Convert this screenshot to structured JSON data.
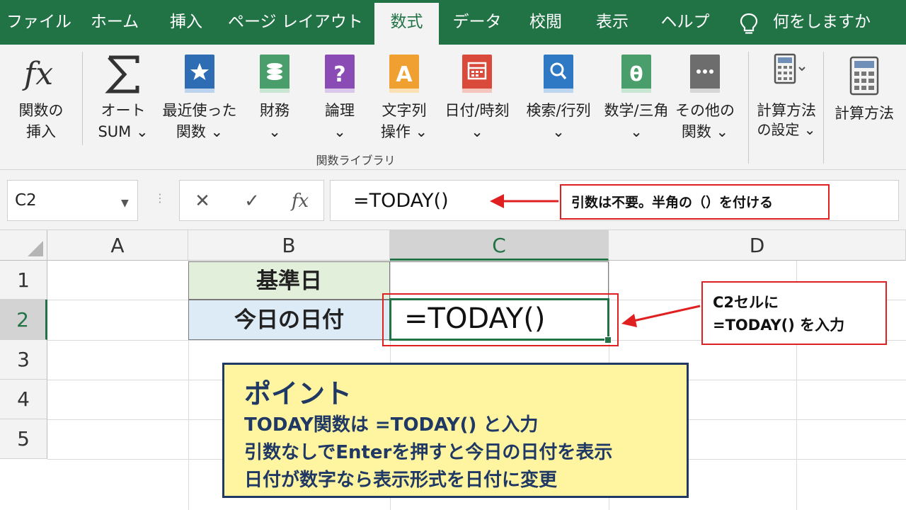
{
  "tabs": [
    {
      "label": "ファイル",
      "active": false
    },
    {
      "label": "ホーム",
      "active": false
    },
    {
      "label": "挿入",
      "active": false
    },
    {
      "label": "ページ レイアウト",
      "active": false
    },
    {
      "label": "数式",
      "active": true
    },
    {
      "label": "データ",
      "active": false
    },
    {
      "label": "校閲",
      "active": false
    },
    {
      "label": "表示",
      "active": false
    },
    {
      "label": "ヘルプ",
      "active": false
    }
  ],
  "tell_me": {
    "icon": "lightbulb-icon",
    "label": "何をしますか"
  },
  "ribbon": {
    "buttons": [
      {
        "icon": "fx-icon",
        "line1": "関数の",
        "line2": "挿入"
      },
      {
        "icon": "sigma-icon",
        "line1": "オート",
        "line2": "SUM ⌄"
      },
      {
        "icon": "star-book-icon",
        "line1": "最近使った",
        "line2": "関数 ⌄",
        "color": "#2e6db4"
      },
      {
        "icon": "coins-book-icon",
        "line1": "財務",
        "line2": "⌄",
        "color": "#4a9e6b"
      },
      {
        "icon": "question-book-icon",
        "line1": "論理",
        "line2": "⌄",
        "color": "#8a4bb5"
      },
      {
        "icon": "letter-a-book-icon",
        "line1": "文字列",
        "line2": "操作 ⌄",
        "color": "#f0a030"
      },
      {
        "icon": "calendar-book-icon",
        "line1": "日付/時刻",
        "line2": "⌄",
        "color": "#d94a3a"
      },
      {
        "icon": "magnifier-book-icon",
        "line1": "検索/行列",
        "line2": "⌄",
        "color": "#2e78c4"
      },
      {
        "icon": "theta-book-icon",
        "line1": "数学/三角",
        "line2": "⌄",
        "color": "#4a9e6b"
      },
      {
        "icon": "dots-book-icon",
        "line1": "その他の",
        "line2": "関数 ⌄",
        "color": "#6d6d6d"
      }
    ],
    "group_label": "関数ライブラリ",
    "calc_options": {
      "icon": "calculator-icon",
      "line1": "計算方法",
      "line2": "の設定 ⌄"
    },
    "calc_now": {
      "icon": "calculator-icon",
      "label": "計算方法"
    }
  },
  "formula_bar": {
    "name_box": "C2",
    "cancel_icon": "✕",
    "enter_icon": "✓",
    "fx_label": "fx",
    "formula": "=TODAY()"
  },
  "grid": {
    "columns": [
      "A",
      "B",
      "C",
      "D"
    ],
    "rows": [
      "1",
      "2",
      "3",
      "4",
      "5"
    ],
    "selected_column": "C",
    "selected_row": "2",
    "cells": {
      "B1": "基準日",
      "B2": "今日の日付",
      "C2": "=TODAY()"
    }
  },
  "annotations": {
    "formula_note": "引数は不要。半角の（）を付ける",
    "cell_note_line1": "C2セルに",
    "cell_note_line2": "=TODAY() を入力",
    "accent": "#e02020"
  },
  "point": {
    "title": "ポイント",
    "lines": [
      "TODAY関数は =TODAY() と入力",
      "引数なしでEnterを押すと今日の日付を表示",
      "日付が数字なら表示形式を日付に変更"
    ]
  },
  "colors": {
    "brand": "#217346",
    "point_bg": "#fff5a0",
    "point_text": "#1f3864"
  }
}
